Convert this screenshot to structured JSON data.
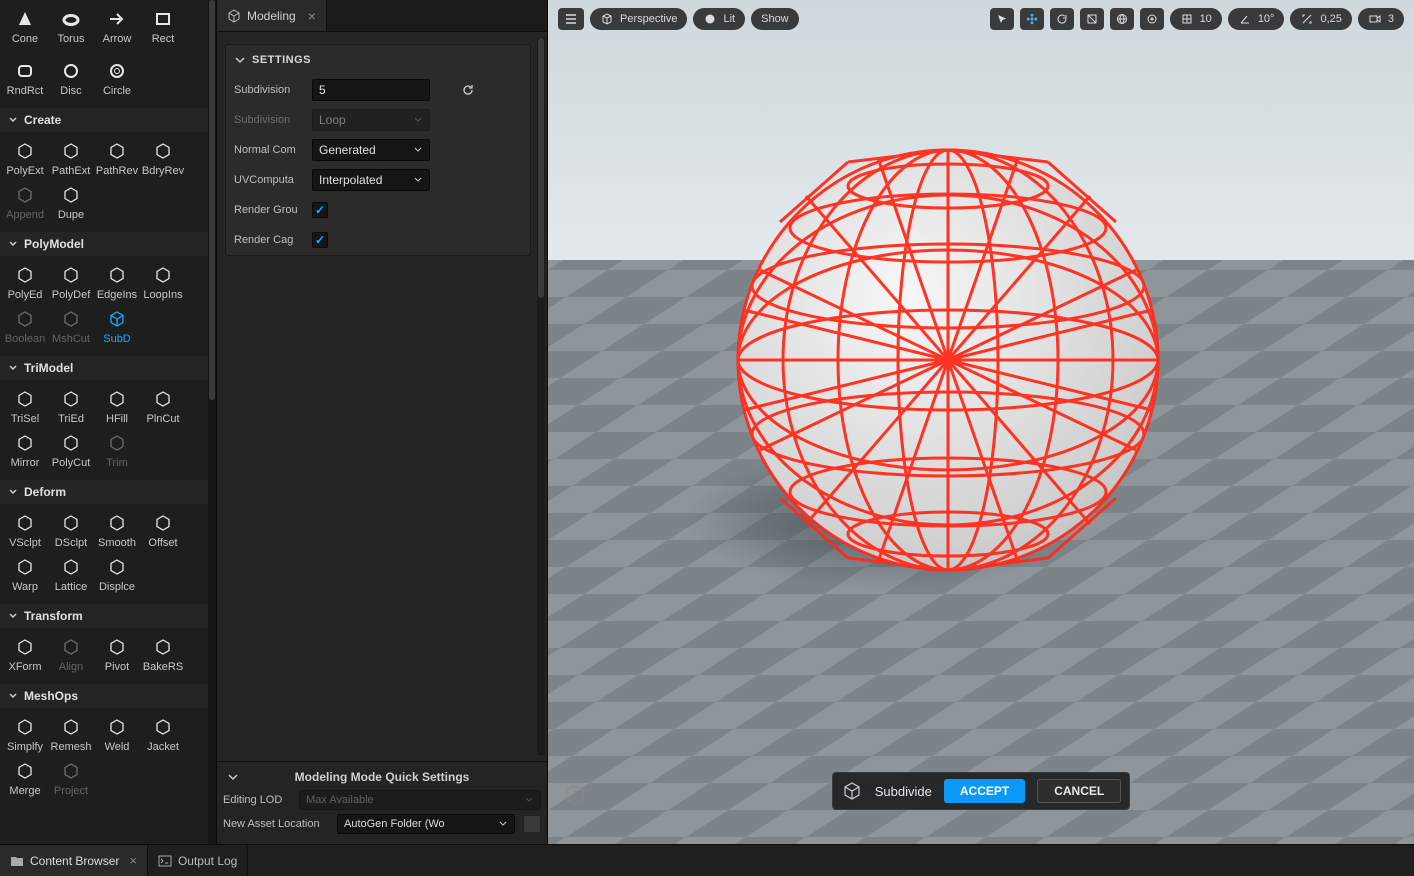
{
  "toolpanel": {
    "truncated_row": [
      {
        "id": "tool-cone",
        "label": "Cone"
      },
      {
        "id": "tool-torus",
        "label": "Torus"
      },
      {
        "id": "tool-arrow",
        "label": "Arrow"
      },
      {
        "id": "tool-rect",
        "label": "Rect"
      }
    ],
    "truncated_row2": [
      {
        "id": "tool-rndrct",
        "label": "RndRct"
      },
      {
        "id": "tool-disc",
        "label": "Disc"
      },
      {
        "id": "tool-circle",
        "label": "Circle"
      }
    ],
    "sections": [
      {
        "title": "Create",
        "items": [
          {
            "id": "tool-polyext",
            "label": "PolyExt"
          },
          {
            "id": "tool-pathext",
            "label": "PathExt"
          },
          {
            "id": "tool-pathrev",
            "label": "PathRev"
          },
          {
            "id": "tool-bdryrev",
            "label": "BdryRev"
          },
          {
            "id": "tool-append",
            "label": "Append",
            "disabled": true
          },
          {
            "id": "tool-dupe",
            "label": "Dupe"
          }
        ]
      },
      {
        "title": "PolyModel",
        "items": [
          {
            "id": "tool-polyed",
            "label": "PolyEd"
          },
          {
            "id": "tool-polydef",
            "label": "PolyDef"
          },
          {
            "id": "tool-edgeins",
            "label": "EdgeIns"
          },
          {
            "id": "tool-loopins",
            "label": "LoopIns"
          },
          {
            "id": "tool-boolean",
            "label": "Boolean",
            "disabled": true
          },
          {
            "id": "tool-mshcut",
            "label": "MshCut",
            "disabled": true
          },
          {
            "id": "tool-subd",
            "label": "SubD",
            "active": true
          }
        ]
      },
      {
        "title": "TriModel",
        "items": [
          {
            "id": "tool-trisel",
            "label": "TriSel"
          },
          {
            "id": "tool-tried",
            "label": "TriEd"
          },
          {
            "id": "tool-hfill",
            "label": "HFill"
          },
          {
            "id": "tool-plncut",
            "label": "PlnCut"
          },
          {
            "id": "tool-mirror",
            "label": "Mirror"
          },
          {
            "id": "tool-polycut",
            "label": "PolyCut"
          },
          {
            "id": "tool-trim",
            "label": "Trim",
            "disabled": true
          }
        ]
      },
      {
        "title": "Deform",
        "items": [
          {
            "id": "tool-vsclpt",
            "label": "VSclpt"
          },
          {
            "id": "tool-dsclpt",
            "label": "DSclpt"
          },
          {
            "id": "tool-smooth",
            "label": "Smooth"
          },
          {
            "id": "tool-offset",
            "label": "Offset"
          },
          {
            "id": "tool-warp",
            "label": "Warp"
          },
          {
            "id": "tool-lattice",
            "label": "Lattice"
          },
          {
            "id": "tool-displce",
            "label": "Displce"
          }
        ]
      },
      {
        "title": "Transform",
        "items": [
          {
            "id": "tool-xform",
            "label": "XForm"
          },
          {
            "id": "tool-align",
            "label": "Align",
            "disabled": true
          },
          {
            "id": "tool-pivot",
            "label": "Pivot"
          },
          {
            "id": "tool-bakers",
            "label": "BakeRS"
          }
        ]
      },
      {
        "title": "MeshOps",
        "items": [
          {
            "id": "tool-simplfy",
            "label": "Simplfy"
          },
          {
            "id": "tool-remesh",
            "label": "Remesh"
          },
          {
            "id": "tool-weld",
            "label": "Weld"
          },
          {
            "id": "tool-jacket",
            "label": "Jacket"
          },
          {
            "id": "tool-merge",
            "label": "Merge"
          },
          {
            "id": "tool-project",
            "label": "Project",
            "disabled": true
          }
        ]
      }
    ]
  },
  "detail": {
    "tab_title": "Modeling",
    "settings_header": "SETTINGS",
    "rows": {
      "subdivision_lbl": "Subdivision",
      "subdivision_val": "5",
      "subdivision2_lbl": "Subdivision",
      "subdivision2_val": "Loop",
      "normal_lbl": "Normal Com",
      "normal_val": "Generated",
      "uv_lbl": "UVComputa",
      "uv_val": "Interpolated",
      "rgroup_lbl": "Render Grou",
      "rgroup_chk": true,
      "rcage_lbl": "Render Cag",
      "rcage_chk": true
    },
    "quick": {
      "title": "Modeling Mode Quick Settings",
      "lod_lbl": "Editing LOD",
      "lod_val": "Max Available",
      "loc_lbl": "New Asset Location",
      "loc_val": "AutoGen Folder (Wo"
    }
  },
  "viewport": {
    "menu": {
      "persp": "Perspective",
      "lit": "Lit",
      "show": "Show"
    },
    "right": {
      "grid": "10",
      "angle": "10°",
      "scale": "0,25",
      "cam": "3"
    },
    "accept": {
      "title": "Subdivide",
      "accept": "ACCEPT",
      "cancel": "CANCEL"
    }
  },
  "bottom": {
    "content": "Content Browser",
    "output": "Output Log"
  }
}
